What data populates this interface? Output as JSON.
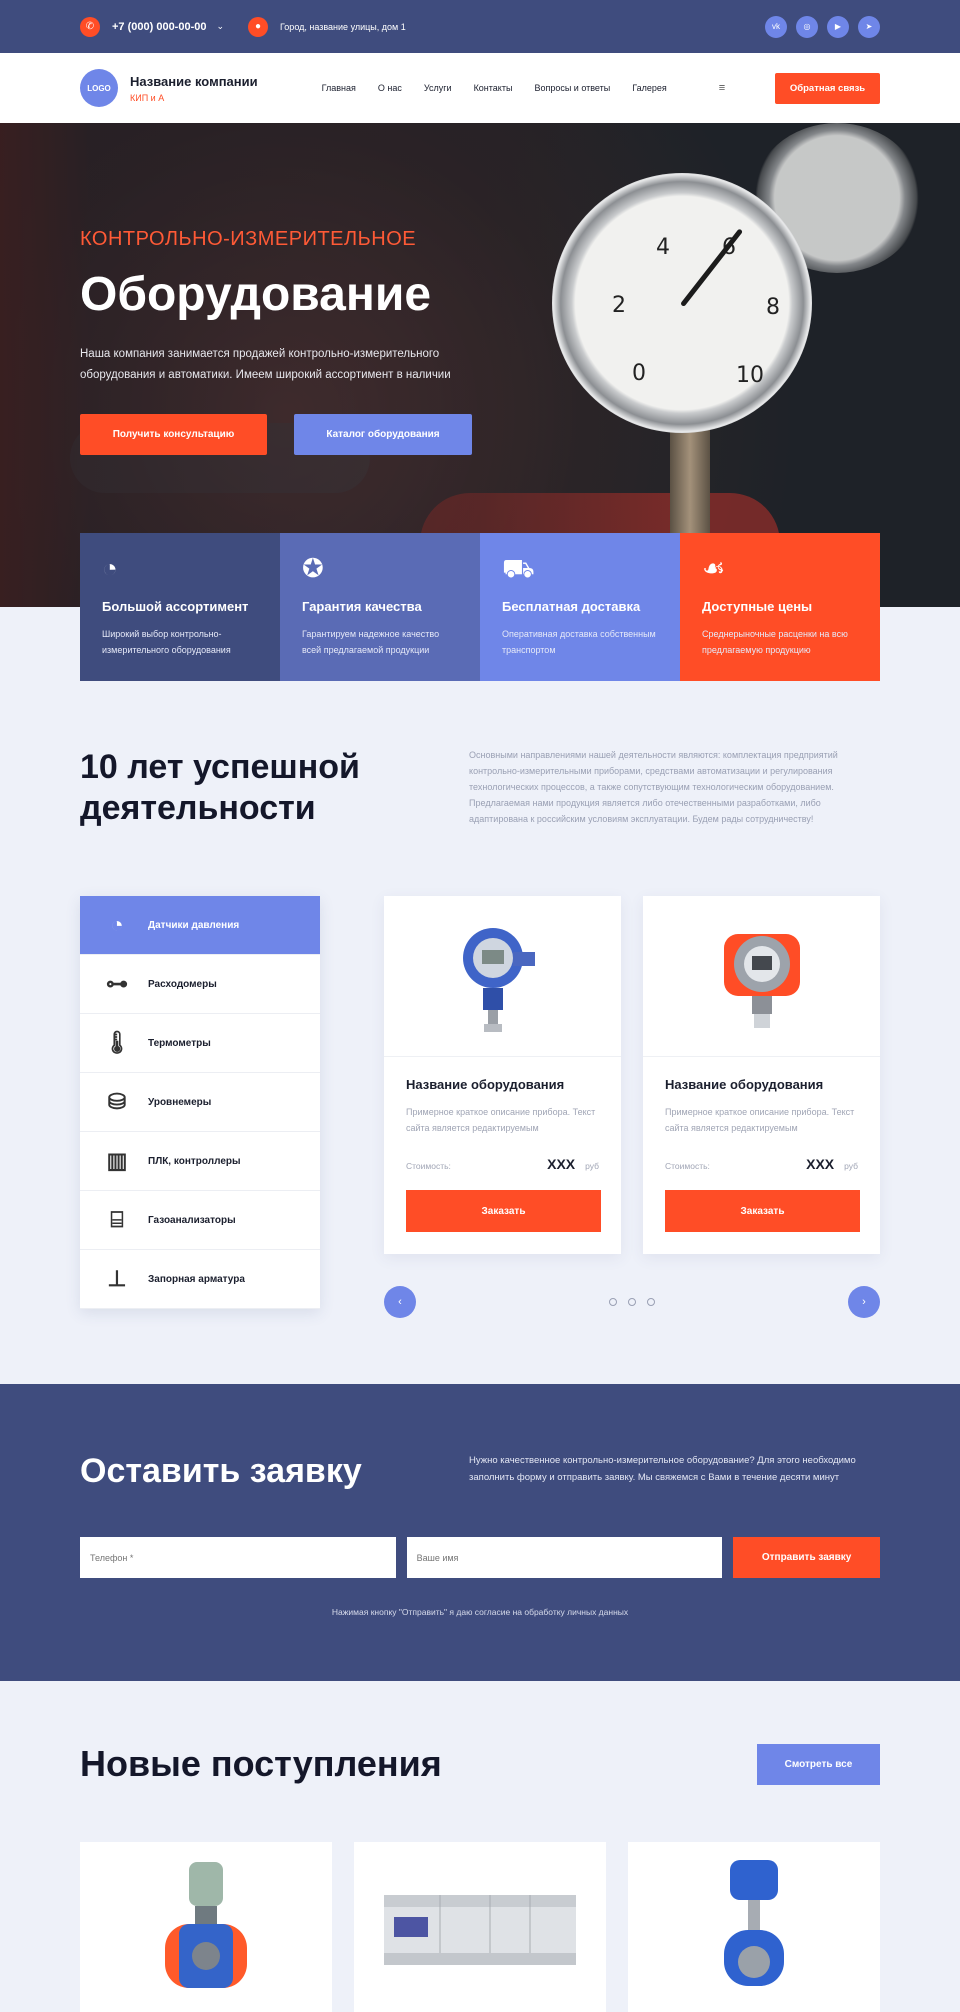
{
  "topbar": {
    "phone": "+7 (000) 000-00-00",
    "address": "Город, название улицы, дом 1",
    "socials": [
      "vk",
      "ig",
      "yt",
      "tg"
    ]
  },
  "header": {
    "logo": "LOGO",
    "company": "Название компании",
    "subtitle": "КИП и А",
    "nav": [
      "Главная",
      "О нас",
      "Услуги",
      "Контакты",
      "Вопросы и ответы",
      "Галерея"
    ],
    "feedback": "Обратная связь"
  },
  "hero": {
    "kicker": "КОНТРОЛЬНО-ИЗМЕРИТЕЛЬНОЕ",
    "title": "Оборудование",
    "text": "Наша компания занимается продажей контрольно-измерительного оборудования и автоматики. Имеем широкий ассортимент в наличии",
    "btn_consult": "Получить консультацию",
    "btn_catalog": "Каталог оборудования",
    "gauge_numbers": [
      "0",
      "2",
      "4",
      "6",
      "8",
      "10"
    ]
  },
  "features": [
    {
      "title": "Большой ассортимент",
      "text": "Широкий выбор контрольно-измерительного оборудования",
      "color": "#3f4c7e",
      "icon": "gauge-icon"
    },
    {
      "title": "Гарантия качества",
      "text": "Гарантируем надежное качество всей предлагаемой продукции",
      "color": "#5a6bb5",
      "icon": "award-icon"
    },
    {
      "title": "Бесплатная доставка",
      "text": "Оперативная доставка собственным транспортом",
      "color": "#6f86e8",
      "icon": "delivery-icon"
    },
    {
      "title": "Доступные цены",
      "text": "Среднерыночные расценки на всю предлагаемую продукцию",
      "color": "#ff4d26",
      "icon": "price-icon"
    }
  ],
  "about": {
    "title": "10 лет успешной деятельности",
    "text": "Основными направлениями нашей деятельности являются: комплектация предприятий контрольно-измерительными приборами, средствами автоматизации и регулирования технологических процессов, а также сопутствующим технологическим оборудованием. Предлагаемая нами продукция является либо отечественными разработками, либо адаптирована к российским условиям эксплуатации. Будем рады сотрудничеству!"
  },
  "categories": [
    {
      "label": "Датчики давления",
      "active": true
    },
    {
      "label": "Расходомеры"
    },
    {
      "label": "Термометры"
    },
    {
      "label": "Уровнемеры"
    },
    {
      "label": "ПЛК, контроллеры"
    },
    {
      "label": "Газоанализаторы"
    },
    {
      "label": "Запорная арматура"
    }
  ],
  "products": [
    {
      "title": "Название оборудования",
      "desc": "Примерное краткое описание прибора. Текст сайта является редактируемым",
      "price_label": "Стоимость:",
      "price": "XXX",
      "currency": "руб",
      "order": "Заказать"
    },
    {
      "title": "Название оборудования",
      "desc": "Примерное краткое описание прибора. Текст сайта является редактируемым",
      "price_label": "Стоимость:",
      "price": "XXX",
      "currency": "руб",
      "order": "Заказать"
    }
  ],
  "request": {
    "title": "Оставить заявку",
    "text": "Нужно качественное контрольно-измерительное оборудование? Для этого необходимо заполнить форму и отправить заявку. Мы свяжемся с Вами в течение десяти минут",
    "phone_placeholder": "Телефон *",
    "name_placeholder": "Ваше имя",
    "submit": "Отправить заявку",
    "note": "Нажимая кнопку \"Отправить\" я даю согласие на обработку личных данных"
  },
  "new_arrivals": {
    "title": "Новые поступления",
    "view_all": "Смотреть все"
  }
}
